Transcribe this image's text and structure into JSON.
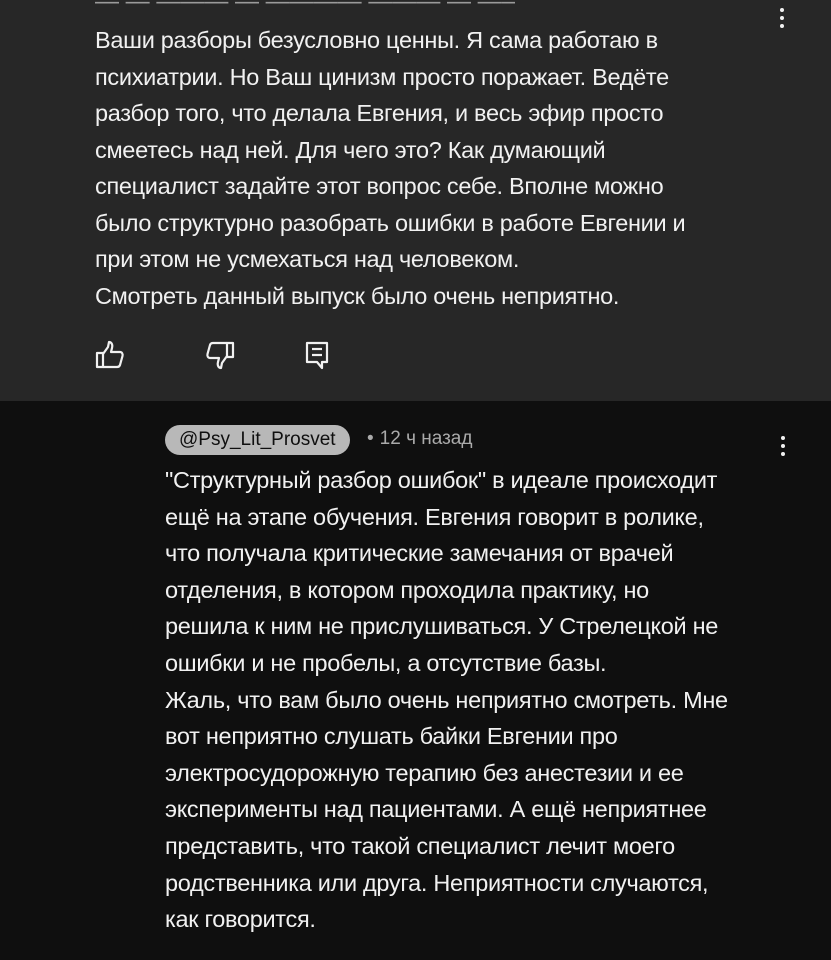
{
  "top_comment": {
    "text": "Ваши разборы безусловно ценны. Я сама работаю в\nпсихиатрии. Но Ваш цинизм просто поражает. Ведёте\nразбор того, что делала Евгения, и весь эфир просто\nсмеетесь над ней. Для чего это? Как думающий\nспециалист задайте этот вопрос себе. Вполне можно\nбыло структурно разобрать ошибки в работе Евгении и\nпри этом не усмехаться над человеком.\nСмотреть данный выпуск было очень неприятно.",
    "icons": [
      "thumbs-up-icon",
      "thumbs-down-icon",
      "reply-icon",
      "more-vert-icon"
    ]
  },
  "reply": {
    "author": "@Psy_Lit_Prosvet",
    "separator": "•",
    "time": "12 ч назад",
    "text": "\"Структурный разбор ошибок\" в идеале происходит\nещё на этапе обучения. Евгения говорит в ролике,\nчто получала критические замечания от врачей\nотделения, в котором проходила практику, но\nрешила к ним не прислушиваться. У Стрелецкой не\nошибки и не пробелы, а отсутствие базы.\nЖаль, что вам было очень неприятно смотреть. Мне\nвот неприятно слушать байки Евгении про\nэлектросудорожную терапию без анестезии и ее\nэксперименты над пациентами. А ещё неприятнее\nпредставить, что такой специалист лечит моего\nродственника или друга. Неприятности случаются,\nкак говорится.",
    "icons": [
      "more-vert-icon"
    ]
  },
  "colors": {
    "top_bg": "#272727",
    "page_bg": "#0f0f0f",
    "text": "#f1f1f1",
    "meta": "#aaaaaa",
    "chip_bg": "#b8b8b8"
  }
}
